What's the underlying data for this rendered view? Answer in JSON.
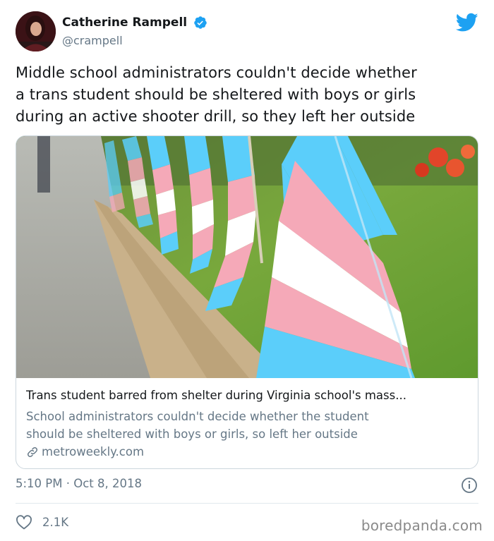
{
  "author": {
    "display_name": "Catherine Rampell",
    "handle": "@crampell",
    "verified": true,
    "avatar_caption": "CATHERINE RAMPELL"
  },
  "tweet": {
    "text_lines": [
      "Middle school administrators couldn't decide whether",
      "a trans student should be sheltered with boys or girls",
      "during an active shooter drill, so they left her outside"
    ]
  },
  "card": {
    "image_icon": "transgender-pride-flags-photo",
    "title": "Trans student barred from shelter during Virginia school's mass...",
    "description_lines": [
      "School administrators couldn't decide whether the student",
      "should be sheltered with boys or girls, so left her outside"
    ],
    "domain": "metroweekly.com"
  },
  "meta": {
    "timestamp": "5:10 PM · Oct 8, 2018",
    "like_count": "2.1K"
  },
  "watermark": "boredpanda.com",
  "colors": {
    "twitter_blue": "#1da1f2",
    "text": "#14171a",
    "secondary": "#657786",
    "flag_blue": "#5bcefa",
    "flag_pink": "#f5a9b8",
    "flag_white": "#ffffff"
  },
  "icons": {
    "verified": "verified-badge-icon",
    "brand": "twitter-bird-icon",
    "link": "link-icon",
    "info": "info-icon",
    "like": "heart-icon"
  }
}
